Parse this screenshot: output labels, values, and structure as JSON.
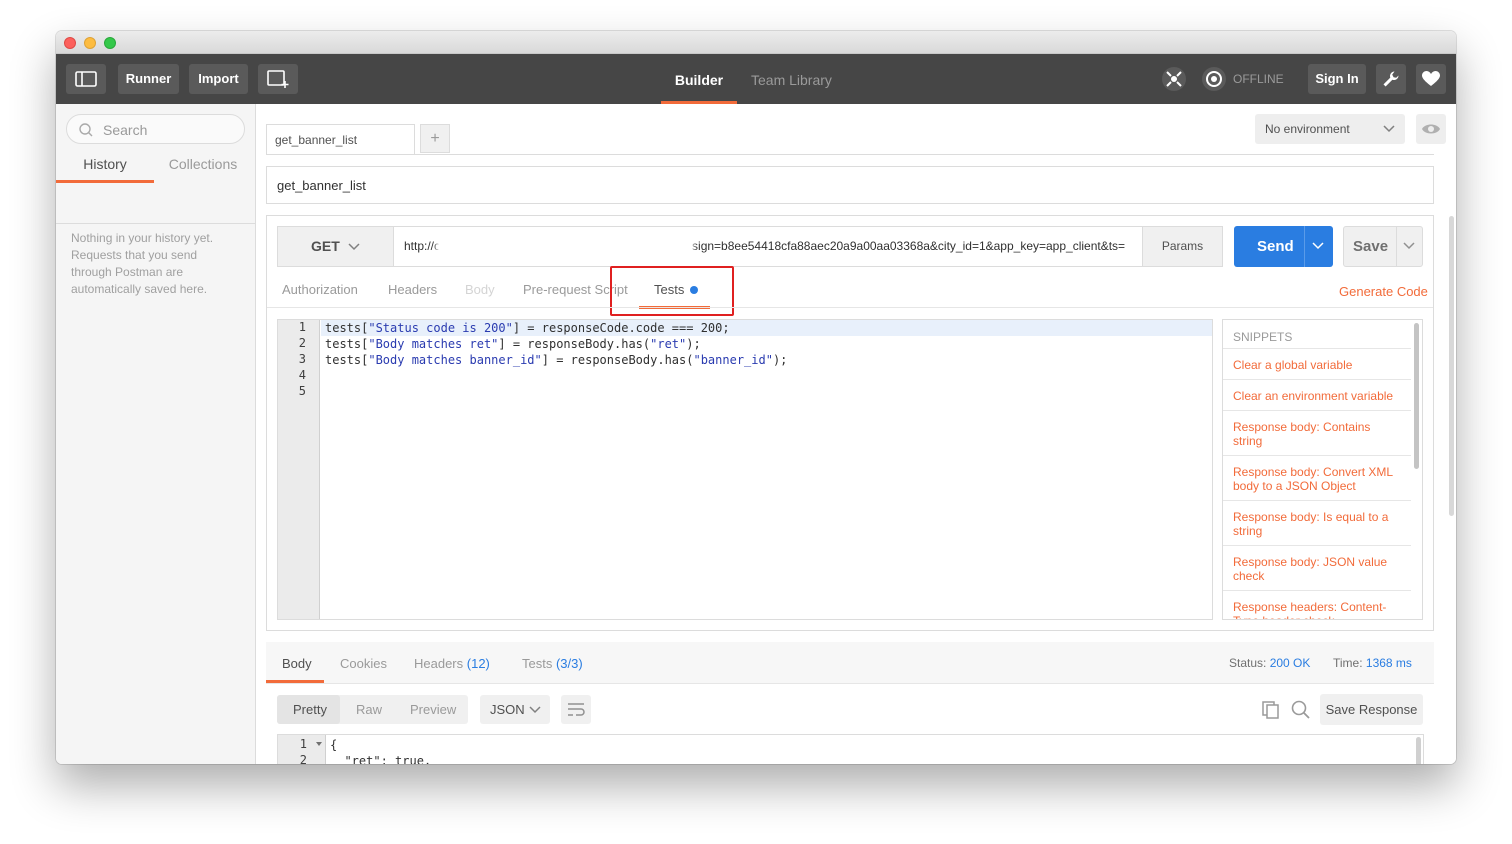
{
  "header": {
    "runner_label": "Runner",
    "import_label": "Import",
    "tabs": [
      {
        "label": "Builder"
      },
      {
        "label": "Team Library"
      }
    ],
    "status_label": "OFFLINE",
    "signin_label": "Sign In"
  },
  "sidebar": {
    "search_placeholder": "Search",
    "tabs": [
      {
        "label": "History"
      },
      {
        "label": "Collections"
      }
    ],
    "empty_message": "Nothing in your history yet. Requests that you send through Postman are automatically saved here."
  },
  "request": {
    "tab_name": "get_banner_list",
    "add_tab_label": "+",
    "environment": "No environment",
    "name": "get_banner_list",
    "method": "GET",
    "url_prefix": "http://c",
    "url_suffix": "sign=b8ee54418cfa88aec20a9a00aa03368a&city_id=1&app_key=app_client&ts=",
    "params_label": "Params",
    "send_label": "Send",
    "save_label": "Save",
    "subtabs": [
      {
        "label": "Authorization"
      },
      {
        "label": "Headers"
      },
      {
        "label": "Body"
      },
      {
        "label": "Pre-request Script"
      },
      {
        "label": "Tests"
      }
    ],
    "generate_code_label": "Generate Code"
  },
  "tests_editor": {
    "line_numbers": [
      "1",
      "2",
      "3",
      "4",
      "5"
    ],
    "lines": [
      {
        "a": "tests[",
        "s": "\"Status code is 200\"",
        "b": "] = responseCode.code === 200;"
      },
      {
        "a": "tests[",
        "s": "\"Body matches ret\"",
        "b": "] = responseBody.has(",
        "s2": "\"ret\"",
        "c": ");"
      },
      {
        "a": "tests[",
        "s": "\"Body matches banner_id\"",
        "b": "] = responseBody.has(",
        "s2": "\"banner_id\"",
        "c": ");"
      }
    ]
  },
  "snippets": {
    "heading": "SNIPPETS",
    "items": [
      "Clear a global variable",
      "Clear an environment variable",
      "Response body: Contains string",
      "Response body: Convert XML body to a JSON Object",
      "Response body: Is equal to a string",
      "Response body: JSON value check",
      "Response headers: Content-Type header check"
    ]
  },
  "response": {
    "tabs": {
      "body": "Body",
      "cookies": "Cookies",
      "headers": "Headers",
      "headers_count": "(12)",
      "tests": "Tests",
      "tests_count": "(3/3)"
    },
    "status_label": "Status:",
    "status_value": "200 OK",
    "time_label": "Time:",
    "time_value": "1368 ms",
    "formats": [
      "Pretty",
      "Raw",
      "Preview"
    ],
    "language": "JSON",
    "save_response_label": "Save Response",
    "line_numbers": [
      "1",
      "2"
    ],
    "lines": [
      "{",
      "  \"ret\": true,"
    ]
  },
  "colors": {
    "accent": "#f26b3a",
    "send": "#2a7de1",
    "header_bg": "#464646"
  }
}
